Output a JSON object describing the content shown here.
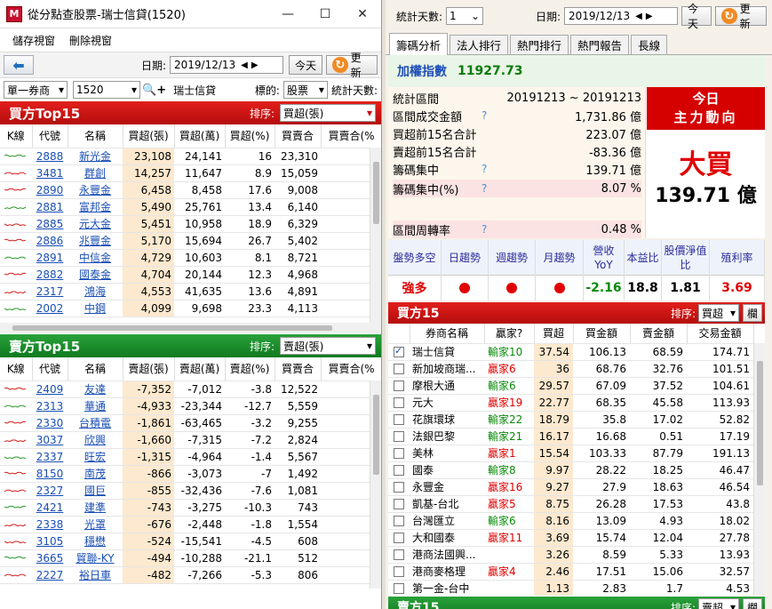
{
  "left": {
    "title": "從分點查股票-瑞士信貸(1520)",
    "menu": [
      "儲存視窗",
      "刪除視窗"
    ],
    "toolbar": {
      "date_label": "日期:",
      "date": "2019/12/13",
      "today": "今天",
      "refresh": "更新"
    },
    "filter": {
      "broker_type": "單一券商",
      "broker_code": "1520",
      "broker_name": "瑞士信貸",
      "target_label": "標的:",
      "target": "股票",
      "days_label": "統計天數:"
    },
    "buy": {
      "title": "買方Top15",
      "sort_label": "排序:",
      "sort": "買超(張)",
      "columns": [
        "K線",
        "代號",
        "名稱",
        "買超(張)",
        "買超(萬)",
        "買超(%)",
        "買賣合",
        "買賣合(%"
      ],
      "rows": [
        [
          "2888",
          "新光金",
          "23,108",
          "24,141",
          "16",
          "23,310"
        ],
        [
          "3481",
          "群創",
          "14,257",
          "11,647",
          "8.9",
          "15,059"
        ],
        [
          "2890",
          "永豐金",
          "6,458",
          "8,458",
          "17.6",
          "9,008"
        ],
        [
          "2881",
          "富邦金",
          "5,490",
          "25,761",
          "13.4",
          "6,140"
        ],
        [
          "2885",
          "元大金",
          "5,451",
          "10,958",
          "18.9",
          "6,329"
        ],
        [
          "2886",
          "兆豐金",
          "5,170",
          "15,694",
          "26.7",
          "5,402"
        ],
        [
          "2891",
          "中信金",
          "4,729",
          "10,603",
          "8.1",
          "8,721"
        ],
        [
          "2882",
          "國泰金",
          "4,704",
          "20,144",
          "12.3",
          "4,968"
        ],
        [
          "2317",
          "鴻海",
          "4,553",
          "41,635",
          "13.6",
          "4,891"
        ],
        [
          "2002",
          "中鋼",
          "4,099",
          "9,698",
          "23.3",
          "4,113"
        ]
      ]
    },
    "sell": {
      "title": "賣方Top15",
      "sort_label": "排序:",
      "sort": "賣超(張)",
      "columns": [
        "K線",
        "代號",
        "名稱",
        "賣超(張)",
        "賣超(萬)",
        "賣超(%)",
        "買賣合",
        "買賣合(%"
      ],
      "rows": [
        [
          "2409",
          "友達",
          "-7,352",
          "-7,012",
          "-3.8",
          "12,522"
        ],
        [
          "2313",
          "華通",
          "-4,933",
          "-23,344",
          "-12.7",
          "5,559"
        ],
        [
          "2330",
          "台積電",
          "-1,861",
          "-63,465",
          "-3.2",
          "9,255"
        ],
        [
          "3037",
          "欣興",
          "-1,660",
          "-7,315",
          "-7.2",
          "2,824"
        ],
        [
          "2337",
          "旺宏",
          "-1,315",
          "-4,964",
          "-1.4",
          "5,567"
        ],
        [
          "8150",
          "南茂",
          "-866",
          "-3,073",
          "-7",
          "1,492"
        ],
        [
          "2327",
          "國巨",
          "-855",
          "-32,436",
          "-7.6",
          "1,081"
        ],
        [
          "2421",
          "建準",
          "-743",
          "-3,275",
          "-10.3",
          "743"
        ],
        [
          "2338",
          "光罩",
          "-676",
          "-2,448",
          "-1.8",
          "1,554"
        ],
        [
          "3105",
          "穩懋",
          "-524",
          "-15,541",
          "-4.5",
          "608"
        ],
        [
          "3665",
          "貿聯-KY",
          "-494",
          "-10,288",
          "-21.1",
          "512"
        ],
        [
          "2227",
          "裕日車",
          "-482",
          "-7,266",
          "-5.3",
          "806"
        ]
      ]
    }
  },
  "right": {
    "toolbar": {
      "days_label": "統計天數:",
      "days": "1",
      "date_label": "日期:",
      "date": "2019/12/13",
      "today": "今天",
      "refresh": "更新"
    },
    "tabs": [
      "籌碼分析",
      "法人排行",
      "熱門排行",
      "熱門報告",
      "長線"
    ],
    "index": {
      "label": "加權指數",
      "value": "11927.73"
    },
    "info": [
      {
        "label": "統計區間",
        "q": false,
        "value": "20191213 ~ 20191213"
      },
      {
        "label": "區間成交金額",
        "q": true,
        "value": "1,731.86 億"
      },
      {
        "label": "買超前15名合計",
        "q": false,
        "value": "223.07 億"
      },
      {
        "label": "賣超前15名合計",
        "q": false,
        "value": "-83.36 億"
      },
      {
        "label": "籌碼集中",
        "q": true,
        "value": "139.71 億"
      },
      {
        "label": "籌碼集中(%)",
        "q": true,
        "value": "8.07 %"
      },
      {
        "label": "區間周轉率",
        "q": true,
        "value": "0.48 %"
      }
    ],
    "today_title": "今日",
    "today_subtitle": "主力動向",
    "today_direction": "大買",
    "today_amount": "139.71 億",
    "stats": {
      "headers": [
        "盤勢多空",
        "日趨勢",
        "週趨勢",
        "月趨勢",
        "營收YoY",
        "本益比",
        "股價淨值比",
        "殖利率"
      ],
      "values": [
        "強多",
        "dot",
        "dot",
        "dot",
        "-2.16",
        "18.8",
        "1.81",
        "3.69"
      ],
      "colors": {
        "bull": "#e00000",
        "yoy": "#0a8a0a",
        "yield": "#e00000"
      }
    },
    "buy15": {
      "title": "買方15",
      "sort_label": "排序:",
      "sort": "買超",
      "btn": "欄",
      "columns": [
        "",
        "券商名稱",
        "贏家?",
        "買超",
        "買金額",
        "賣金額",
        "交易金額"
      ],
      "rows": [
        {
          "checked": true,
          "name": "瑞士信貸",
          "winner": "輸家10",
          "w": "win",
          "net": "37.54",
          "buy": "106.13",
          "sell": "68.59",
          "total": "174.71"
        },
        {
          "checked": false,
          "name": "新加坡商瑞...",
          "winner": "贏家6",
          "w": "loss",
          "net": "36",
          "buy": "68.76",
          "sell": "32.76",
          "total": "101.51"
        },
        {
          "checked": false,
          "name": "摩根大通",
          "winner": "輸家6",
          "w": "win",
          "net": "29.57",
          "buy": "67.09",
          "sell": "37.52",
          "total": "104.61"
        },
        {
          "checked": false,
          "name": "元大",
          "winner": "贏家19",
          "w": "loss",
          "net": "22.77",
          "buy": "68.35",
          "sell": "45.58",
          "total": "113.93"
        },
        {
          "checked": false,
          "name": "花旗環球",
          "winner": "輸家22",
          "w": "win",
          "net": "18.79",
          "buy": "35.8",
          "sell": "17.02",
          "total": "52.82"
        },
        {
          "checked": false,
          "name": "法銀巴黎",
          "winner": "輸家21",
          "w": "win",
          "net": "16.17",
          "buy": "16.68",
          "sell": "0.51",
          "total": "17.19"
        },
        {
          "checked": false,
          "name": "美林",
          "winner": "贏家1",
          "w": "loss",
          "net": "15.54",
          "buy": "103.33",
          "sell": "87.79",
          "total": "191.13"
        },
        {
          "checked": false,
          "name": "國泰",
          "winner": "輸家8",
          "w": "win",
          "net": "9.97",
          "buy": "28.22",
          "sell": "18.25",
          "total": "46.47"
        },
        {
          "checked": false,
          "name": "永豐金",
          "winner": "贏家16",
          "w": "loss",
          "net": "9.27",
          "buy": "27.9",
          "sell": "18.63",
          "total": "46.54"
        },
        {
          "checked": false,
          "name": "凱基-台北",
          "winner": "贏家5",
          "w": "loss",
          "net": "8.75",
          "buy": "26.28",
          "sell": "17.53",
          "total": "43.8"
        },
        {
          "checked": false,
          "name": "台灣匯立",
          "winner": "輸家6",
          "w": "win",
          "net": "8.16",
          "buy": "13.09",
          "sell": "4.93",
          "total": "18.02"
        },
        {
          "checked": false,
          "name": "大和國泰",
          "winner": "贏家11",
          "w": "loss",
          "net": "3.69",
          "buy": "15.74",
          "sell": "12.04",
          "total": "27.78"
        },
        {
          "checked": false,
          "name": "港商法國興...",
          "winner": "",
          "w": "",
          "net": "3.26",
          "buy": "8.59",
          "sell": "5.33",
          "total": "13.93"
        },
        {
          "checked": false,
          "name": "港商麥格理",
          "winner": "贏家4",
          "w": "loss",
          "net": "2.46",
          "buy": "17.51",
          "sell": "15.06",
          "total": "32.57"
        },
        {
          "checked": false,
          "name": "第一金-台中",
          "winner": "",
          "w": "",
          "net": "1.13",
          "buy": "2.83",
          "sell": "1.7",
          "total": "4.53"
        }
      ]
    },
    "sell15": {
      "title": "賣方15",
      "sort_label": "排序:",
      "sort": "賣超",
      "btn": "欄"
    }
  }
}
